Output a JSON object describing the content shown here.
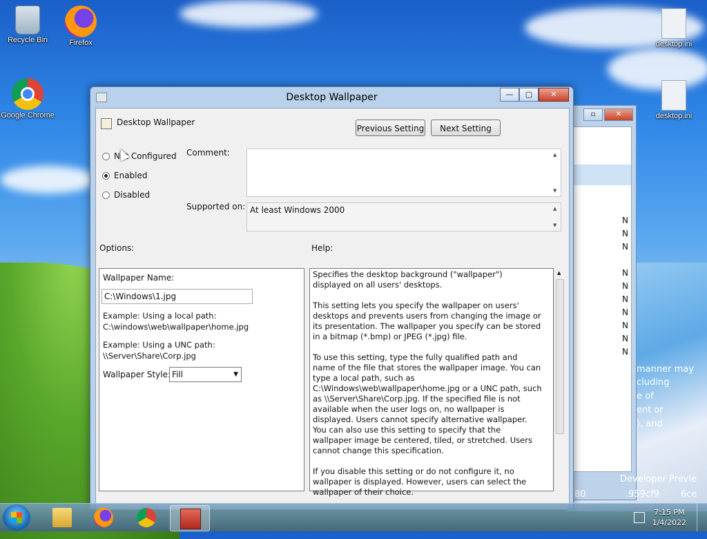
{
  "desktop": {
    "icons": [
      {
        "label": "Recycle Bin"
      },
      {
        "label": "Firefox"
      },
      {
        "label": "Google Chrome"
      },
      {
        "label": "desktop.ini"
      },
      {
        "label": "desktop.ini"
      }
    ],
    "bg_window_rows": [
      "N",
      "N",
      "N",
      "N",
      "N",
      "N",
      "N",
      "N",
      "N",
      "N"
    ],
    "overlay_text": [
      "manner may",
      "cluding",
      "e of",
      "ent or",
      "), and",
      "Developer Previe",
      "80",
      ".959cf9",
      "6ce"
    ]
  },
  "dialog": {
    "window_title": "Desktop Wallpaper",
    "header_title": "Desktop Wallpaper",
    "prev_button": "Previous Setting",
    "next_button": "Next Setting",
    "radios": [
      {
        "label": "Not Configured",
        "selected": false
      },
      {
        "label": "Enabled",
        "selected": true
      },
      {
        "label": "Disabled",
        "selected": false
      }
    ],
    "comment_label": "Comment:",
    "comment_value": "",
    "supported_label": "Supported on:",
    "supported_value": "At least Windows 2000",
    "options_label": "Options:",
    "help_label": "Help:",
    "options": {
      "wallpaper_name_label": "Wallpaper Name:",
      "wallpaper_name_value": "C:\\Windows\\1.jpg",
      "example_local_1": "Example: Using a local path:",
      "example_local_2": "C:\\windows\\web\\wallpaper\\home.jpg",
      "example_unc_1": "Example: Using a UNC path:",
      "example_unc_2": "\\\\Server\\Share\\Corp.jpg",
      "style_label": "Wallpaper Style:",
      "style_value": "Fill"
    },
    "help": {
      "p1": "Specifies the desktop background (\"wallpaper\") displayed on all users' desktops.",
      "p2": "This setting lets you specify the wallpaper on users' desktops and prevents users from changing the image or its presentation. The wallpaper you specify can be stored in a bitmap (*.bmp) or JPEG (*.jpg) file.",
      "p3": "To use this setting, type the fully qualified path and name of the file that stores the wallpaper image. You can type a local path, such as C:\\Windows\\web\\wallpaper\\home.jpg or a UNC path, such as \\\\Server\\Share\\Corp.jpg. If the specified file is not available when the user logs on, no wallpaper is displayed. Users cannot specify alternative wallpaper. You can also use this setting to specify that the wallpaper image be centered, tiled, or stretched. Users cannot change this specification.",
      "p4": "If you disable this setting or do not configure it, no wallpaper is displayed. However, users can select the wallpaper of their choice."
    }
  },
  "taskbar": {
    "time": "7:15 PM",
    "date": "1/4/2022"
  }
}
